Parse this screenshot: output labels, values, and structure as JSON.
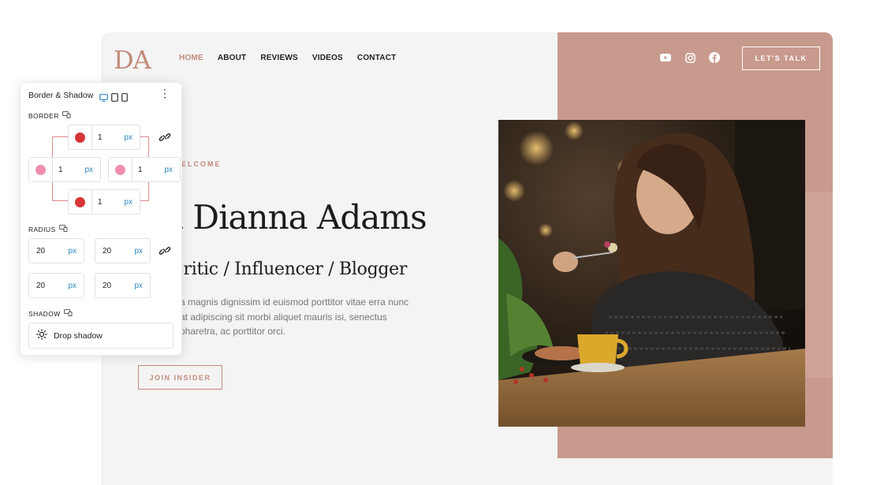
{
  "site": {
    "logo": "DA",
    "nav": [
      "HOME",
      "ABOUT",
      "REVIEWS",
      "VIDEOS",
      "CONTACT"
    ],
    "social_icons": [
      "youtube-icon",
      "instagram-icon",
      "facebook-icon"
    ],
    "cta_label": "LET'S TALK",
    "welcome": "ELCOME",
    "headline": "n Dianna Adams",
    "subline": "Critic / Influencer / Blogger",
    "paragraph": "a magnis dignissim id euismod porttitor vitae erra nunc at adipiscing sit morbi aliquet mauris isi, senectus pharetra, ac porttitor orci.",
    "join_label": "JOIN INSIDER",
    "colors": {
      "accent": "#c28b7b",
      "pink_block": "#c89a8d",
      "dark": "#1c1c1c"
    }
  },
  "panel": {
    "title": "Border & Shadow",
    "border_label": "BORDER",
    "border": {
      "top": {
        "value": "1",
        "unit": "px",
        "color": "#d63638"
      },
      "left": {
        "value": "1",
        "unit": "px",
        "color": "#f08eb0"
      },
      "right": {
        "value": "1",
        "unit": "px",
        "color": "#f08eb0"
      },
      "bottom": {
        "value": "1",
        "unit": "px",
        "color": "#d63638"
      }
    },
    "radius_label": "RADIUS",
    "radius": {
      "tl": {
        "value": "20",
        "unit": "px"
      },
      "tr": {
        "value": "20",
        "unit": "px"
      },
      "bl": {
        "value": "20",
        "unit": "px"
      },
      "br": {
        "value": "20",
        "unit": "px"
      }
    },
    "shadow_label": "SHADOW",
    "shadow_button": "Drop shadow"
  }
}
